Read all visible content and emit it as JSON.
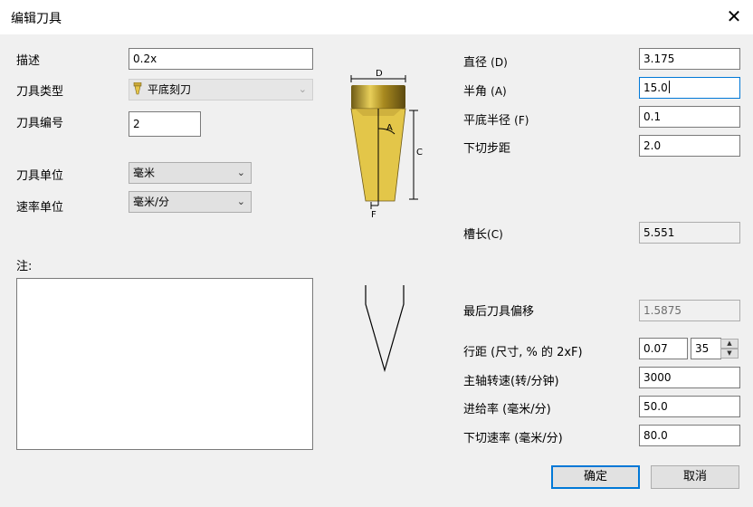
{
  "window": {
    "title": "编辑刀具"
  },
  "left": {
    "desc_label": "描述",
    "desc_value": "0.2x",
    "tooltype_label": "刀具类型",
    "tooltype_value": "平底刻刀",
    "toolnum_label": "刀具编号",
    "toolnum_value": "2",
    "toolunit_label": "刀具单位",
    "toolunit_value": "毫米",
    "rateunit_label": "速率单位",
    "rateunit_value": "毫米/分",
    "notes_label": "注:"
  },
  "diagram": {
    "d": "D",
    "a": "A",
    "c": "C",
    "f": "F"
  },
  "right": {
    "diameter_label": "直径",
    "diameter_suffix": "(D)",
    "diameter_value": "3.175",
    "halfangle_label": "半角",
    "halfangle_suffix": "(A)",
    "halfangle_value": "15.0",
    "flatradius_label": "平底半径",
    "flatradius_suffix": "(F)",
    "flatradius_value": "0.1",
    "stepdown_label": "下切步距",
    "stepdown_value": "2.0",
    "flutelen_label": "槽长",
    "flutelen_suffix": "(C)",
    "flutelen_value": "5.551",
    "lastoffset_label": "最后刀具偏移",
    "lastoffset_value": "1.5875",
    "stepover_label": "行距 (尺寸, % 的 2xF)",
    "stepover_value": "0.07",
    "stepover_percent": "35",
    "spindle_label": "主轴转速(转/分钟)",
    "spindle_value": "3000",
    "feed_label": "进给率 (毫米/分)",
    "feed_value": "50.0",
    "plunge_label": "下切速率 (毫米/分)",
    "plunge_value": "80.0"
  },
  "buttons": {
    "ok": "确定",
    "cancel": "取消"
  }
}
